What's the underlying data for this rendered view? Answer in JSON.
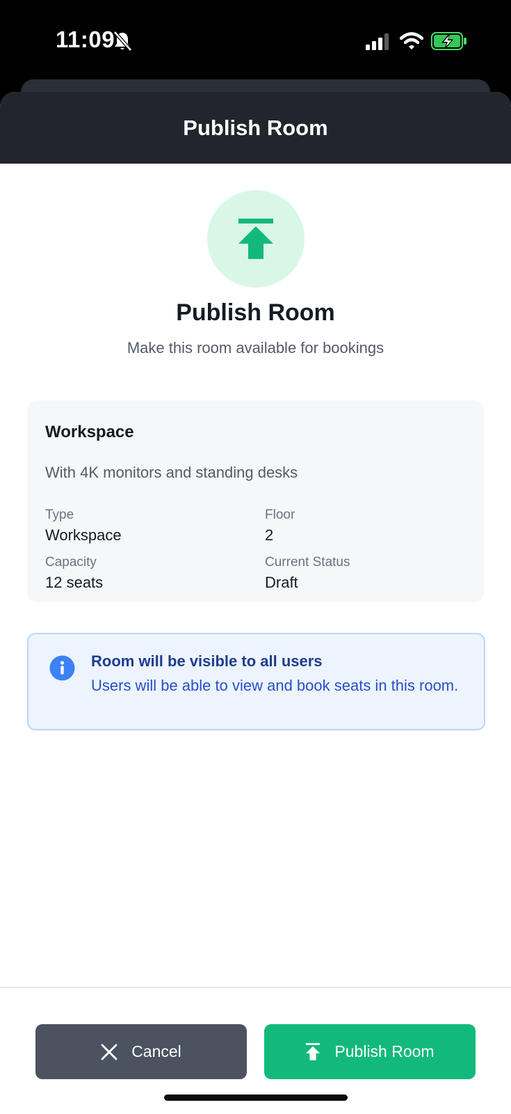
{
  "status_bar": {
    "time": "11:09"
  },
  "header": {
    "title": "Publish Room"
  },
  "hero": {
    "title": "Publish Room",
    "subtitle": "Make this room available for bookings"
  },
  "room": {
    "name": "Workspace",
    "description": "With 4K monitors and standing desks",
    "fields": [
      {
        "label": "Type",
        "value": "Workspace"
      },
      {
        "label": "Floor",
        "value": "2"
      },
      {
        "label": "Capacity",
        "value": "12 seats"
      },
      {
        "label": "Current Status",
        "value": "Draft"
      }
    ]
  },
  "info": {
    "title": "Room will be visible to all users",
    "text": "Users will be able to view and book seats in this room."
  },
  "actions": {
    "cancel_label": "Cancel",
    "publish_label": "Publish Room"
  },
  "icons": {
    "hero": "upload-arrow-icon",
    "info": "info-icon",
    "cancel": "close-icon",
    "publish": "upload-arrow-icon"
  },
  "colors": {
    "accent_green": "#13b97c",
    "hero_circle_bg": "#d9f7e6",
    "header_bg": "#22252c",
    "info_bg": "#edf4fe",
    "info_text": "#2650c8",
    "cancel_bg": "#4b5361"
  }
}
